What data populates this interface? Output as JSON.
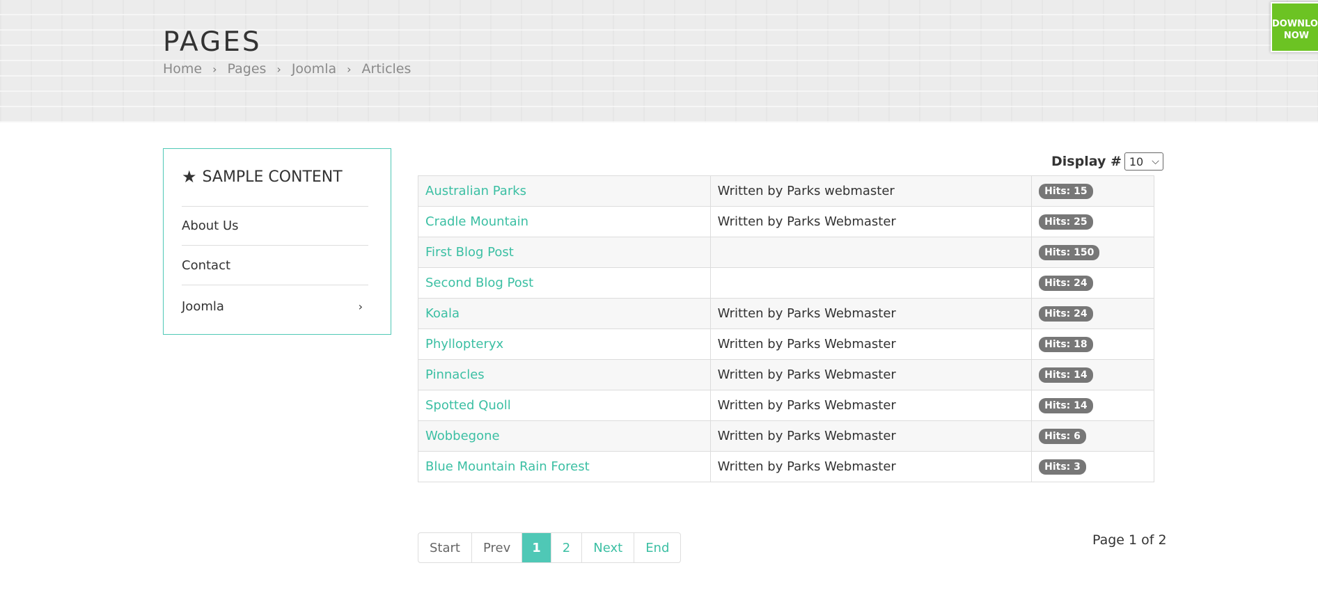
{
  "header": {
    "title": "PAGES",
    "breadcrumb": [
      "Home",
      "Pages",
      "Joomla",
      "Articles"
    ],
    "breadcrumb_separator": "›"
  },
  "download": {
    "line1": "DOWNLOAD",
    "line2": "NOW",
    "color": "#6cc323"
  },
  "sidebar": {
    "title": "SAMPLE CONTENT",
    "title_icon": "star-icon",
    "items": [
      {
        "label": "About Us"
      },
      {
        "label": "Contact"
      },
      {
        "label": "Joomla",
        "has_submenu": true,
        "chevron": "›"
      }
    ],
    "border_color": "#4fc8b6"
  },
  "display": {
    "label": "Display #",
    "selected": "10",
    "caret": "⌄"
  },
  "articles": [
    {
      "title": "Australian Parks",
      "author": "Written by Parks webmaster",
      "hits": "Hits: 15"
    },
    {
      "title": "Cradle Mountain",
      "author": "Written by Parks Webmaster",
      "hits": "Hits: 25"
    },
    {
      "title": "First Blog Post",
      "author": "",
      "hits": "Hits: 150"
    },
    {
      "title": "Second Blog Post",
      "author": "",
      "hits": "Hits: 24"
    },
    {
      "title": "Koala",
      "author": "Written by Parks Webmaster",
      "hits": "Hits: 24"
    },
    {
      "title": "Phyllopteryx",
      "author": "Written by Parks Webmaster",
      "hits": "Hits: 18"
    },
    {
      "title": "Pinnacles",
      "author": "Written by Parks Webmaster",
      "hits": "Hits: 14"
    },
    {
      "title": "Spotted Quoll",
      "author": "Written by Parks Webmaster",
      "hits": "Hits: 14"
    },
    {
      "title": "Wobbegone",
      "author": "Written by Parks Webmaster",
      "hits": "Hits: 6"
    },
    {
      "title": "Blue Mountain Rain Forest",
      "author": "Written by Parks Webmaster",
      "hits": "Hits: 3"
    }
  ],
  "pagination": {
    "start": "Start",
    "prev": "Prev",
    "pages": [
      "1",
      "2"
    ],
    "current": "1",
    "next": "Next",
    "end": "End",
    "counter": "Page 1 of 2"
  },
  "colors": {
    "accent": "#4fc8b6",
    "link": "#3bbfa3",
    "badge": "#777777"
  }
}
